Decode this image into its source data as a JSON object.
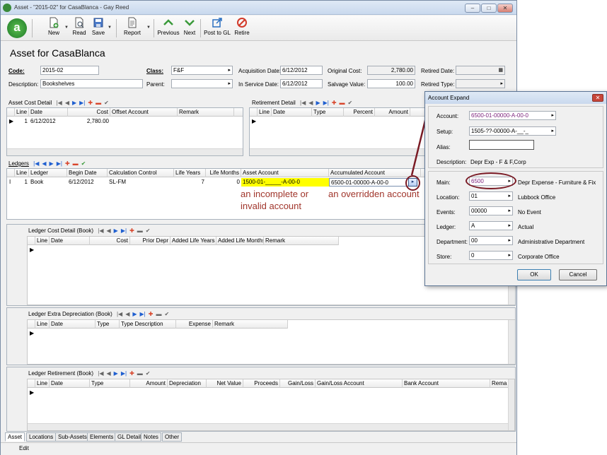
{
  "window": {
    "title": "Asset - \"2015-02\" for CasaBlanca - Gay Reed",
    "controls": [
      "–",
      "□",
      "✕"
    ]
  },
  "toolbar": {
    "logo": "a",
    "new": "New",
    "read": "Read",
    "save": "Save",
    "report": "Report",
    "previous": "Previous",
    "next": "Next",
    "post_to_gl": "Post to GL",
    "retire": "Retire"
  },
  "page_title": "Asset for CasaBlanca",
  "form": {
    "code_label": "Code:",
    "code_value": "2015-02",
    "description_label": "Description:",
    "description_value": "Bookshelves",
    "class_label": "Class:",
    "class_value": "F&F",
    "parent_label": "Parent:",
    "parent_value": "",
    "acq_date_label": "Acquisition Date:",
    "acq_date_value": "6/12/2012",
    "service_date_label": "In Service Date:",
    "service_date_value": "6/12/2012",
    "original_cost_label": "Original Cost:",
    "original_cost_value": "2,780.00",
    "salvage_label": "Salvage Value:",
    "salvage_value": "100.00",
    "retired_date_label": "Retired Date:",
    "retired_type_label": "Retired Type:"
  },
  "asset_cost_detail": {
    "title": "Asset Cost Detail",
    "columns": [
      "Line",
      "Date",
      "Cost",
      "Offset Account",
      "Remark"
    ],
    "rows": [
      {
        "line": "1",
        "date": "6/12/2012",
        "cost": "2,780.00",
        "offset": "",
        "remark": ""
      }
    ]
  },
  "retirement_detail": {
    "title": "Retirement Detail",
    "columns": [
      "Line",
      "Date",
      "Type",
      "Percent",
      "Amount"
    ]
  },
  "ledgers": {
    "title": "Ledgers",
    "columns": [
      "Line",
      "Ledger",
      "Begin Date",
      "Calculation Control",
      "Life Years",
      "Life Months",
      "Asset Account",
      "Accumulated Account"
    ],
    "row": {
      "indicator": "I",
      "line": "1",
      "ledger": "Book",
      "begin_date": "6/12/2012",
      "calc": "SL-FM",
      "life_years": "7",
      "life_months": "0",
      "asset_account": "1500-01-_____-A-00-0",
      "accum_account": "6500-01-00000-A-00-0"
    }
  },
  "annotations": {
    "incomplete_1": "an incomplete or",
    "incomplete_2": "invalid account",
    "overridden": "an overridden account"
  },
  "ledger_cost_detail": {
    "title": "Ledger Cost Detail (Book)",
    "columns": [
      "Line",
      "Date",
      "Cost",
      "Prior Depr",
      "Added Life Years",
      "Added Life Months",
      "Remark"
    ]
  },
  "ledger_extra_depr": {
    "title": "Ledger Extra Depreciation (Book)",
    "columns": [
      "Line",
      "Date",
      "Type",
      "Type Description",
      "Expense",
      "Remark"
    ]
  },
  "ledger_retirement": {
    "title": "Ledger Retirement (Book)",
    "columns": [
      "Line",
      "Date",
      "Type",
      "Amount",
      "Depreciation",
      "Net Value",
      "Proceeds",
      "Gain/Loss",
      "Gain/Loss Account",
      "Bank Account",
      "Rema"
    ]
  },
  "tabs": [
    "Asset",
    "Locations",
    "Sub-Assets",
    "Elements",
    "GL Detail",
    "Notes",
    "Other"
  ],
  "status": "Edit",
  "dialog": {
    "title": "Account Expand",
    "close": "✕",
    "account_label": "Account:",
    "account_value": "6500-01-00000-A-00-0",
    "setup_label": "Setup:",
    "setup_value": "1505-??-00000-A-__-_",
    "alias_label": "Alias:",
    "alias_value": "",
    "description_label": "Description:",
    "description_value": "Depr Exp - F & F,Corp",
    "segments": [
      {
        "label": "Main:",
        "value": "6500",
        "desc": "Depr Expense - Furniture & Fixtu"
      },
      {
        "label": "Location:",
        "value": "01",
        "desc": "Lubbock Office"
      },
      {
        "label": "Events:",
        "value": "00000",
        "desc": "No Event"
      },
      {
        "label": "Ledger:",
        "value": "A",
        "desc": "Actual"
      },
      {
        "label": "Department:",
        "value": "00",
        "desc": "Administrative Department"
      },
      {
        "label": "Store:",
        "value": "0",
        "desc": "Corporate Office"
      }
    ],
    "ok": "OK",
    "cancel": "Cancel"
  },
  "colors": {
    "invalid_bg": "#ffff00",
    "annotation": "#a0352b",
    "dialog_value": "#7a1f7a"
  }
}
